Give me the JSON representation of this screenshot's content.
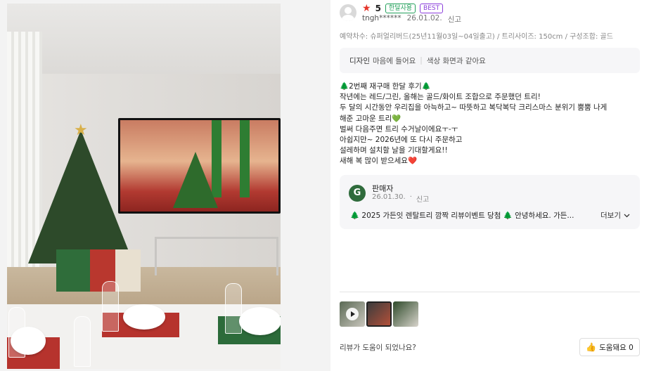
{
  "review": {
    "rating": "5",
    "badges": [
      "한달사용",
      "BEST"
    ],
    "user": "tngh******",
    "date": "26.01.02.",
    "report": "신고",
    "options": "예약차수: 슈퍼얼리버드(25년11월03일~04일출고) / 트리사이즈: 150cm / 구성조합: 골드",
    "tags": [
      {
        "label": "디자인",
        "value": "마음에 들어요"
      },
      {
        "label": "",
        "value": "색상 화면과 같아요"
      }
    ],
    "body_lines": [
      "🌲2번째 재구매 한달 후기🌲",
      "작년에는 레드/그린, 올해는 골드/화이트 조합으로 주문했던 트리!",
      "두 달의 시간동안 우리집을 아늑하고~ 따뜻하고 복닥복닥 크리스마스 분위기 뿜뿜 나게",
      "해준 고마운 트리💚",
      "벌써 다음주면 트리 수거날이에요ㅜ-ㅜ",
      "아쉽지만~ 2026년에 또 다시 주문하고",
      "설레하며 설치할 날을 기대할게요!!",
      "새해 복 많이 받으세요❤️"
    ],
    "seller": {
      "logo": "G",
      "name": "판매자",
      "date": "26.01.30.",
      "report": "신고",
      "message": "🌲 2025 가든잇 렌탈트리 깜짝 리뷰이벤트 당첨 🌲 안녕하세요. 가든...",
      "more_label": "더보기"
    },
    "thumbnails": [
      {
        "icon": "play-icon"
      },
      {
        "icon": ""
      },
      {
        "icon": ""
      }
    ],
    "helpful_question": "리뷰가 도움이 되었나요?",
    "helpful_button": "도움돼요 0"
  },
  "colors": {
    "star": "#e5352b",
    "badge_green": "#22a05a",
    "badge_purple": "#8a3ddb",
    "seller_logo": "#2f6b3c"
  }
}
